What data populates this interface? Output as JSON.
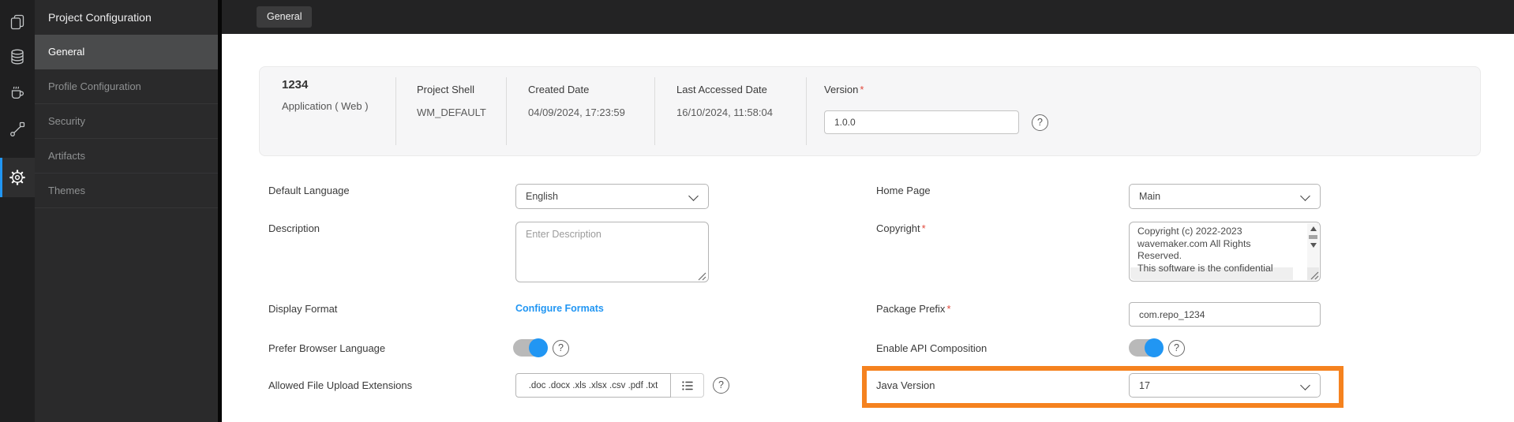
{
  "colors": {
    "accent_blue": "#2196F3",
    "highlight_orange": "#F5821F"
  },
  "icon_rail": {
    "items": [
      {
        "name": "pages-icon"
      },
      {
        "name": "database-icon"
      },
      {
        "name": "java-services-icon"
      },
      {
        "name": "orchestration-icon"
      },
      {
        "name": "settings-gear-icon",
        "active": true
      }
    ]
  },
  "sidebar": {
    "title": "Project Configuration",
    "items": [
      {
        "label": "General",
        "active": true
      },
      {
        "label": "Profile Configuration"
      },
      {
        "label": "Security"
      },
      {
        "label": "Artifacts"
      },
      {
        "label": "Themes"
      }
    ]
  },
  "topbar": {
    "active_tab": "General"
  },
  "project_card": {
    "name": "1234",
    "type": "Application ( Web )",
    "fields": [
      {
        "label": "Project Shell",
        "value": "WM_DEFAULT"
      },
      {
        "label": "Created Date",
        "value": "04/09/2024, 17:23:59"
      },
      {
        "label": "Last Accessed Date",
        "value": "16/10/2024, 11:58:04"
      }
    ],
    "version": {
      "label": "Version",
      "required": "*",
      "value": "1.0.0"
    }
  },
  "form": {
    "default_language": {
      "label": "Default Language",
      "value": "English"
    },
    "description": {
      "label": "Description",
      "placeholder": "Enter Description"
    },
    "display_format": {
      "label": "Display Format",
      "link": "Configure Formats"
    },
    "prefer_browser_language": {
      "label": "Prefer Browser Language",
      "state": "on"
    },
    "allowed_extensions": {
      "label": "Allowed File Upload Extensions",
      "value": ".doc .docx .xls .xlsx .csv .pdf .txt"
    },
    "home_page": {
      "label": "Home Page",
      "value": "Main"
    },
    "copyright": {
      "label": "Copyright",
      "required": "*",
      "lines": [
        "Copyright (c) 2022-2023",
        "wavemaker.com All Rights",
        "Reserved.",
        " This software is the confidential"
      ]
    },
    "package_prefix": {
      "label": "Package Prefix",
      "required": "*",
      "value": "com.repo_1234"
    },
    "enable_api_composition": {
      "label": "Enable API Composition",
      "state": "on"
    },
    "java_version": {
      "label": "Java Version",
      "value": "17"
    }
  }
}
